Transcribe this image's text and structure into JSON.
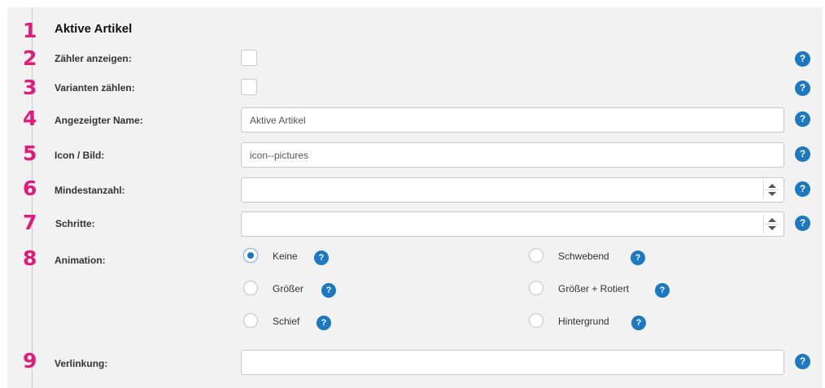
{
  "section": {
    "title": "Aktive Artikel",
    "help_glyph": "?"
  },
  "rows": {
    "show_counter": {
      "step": "1",
      "number": "2",
      "label": "Zähler anzeigen:",
      "checked": false
    },
    "count_variants": {
      "number": "3",
      "label": "Varianten zählen:",
      "checked": false
    },
    "display_name": {
      "number": "4",
      "label": "Angezeigter Name:",
      "value": "Aktive Artikel"
    },
    "icon": {
      "number": "5",
      "label": "Icon / Bild:",
      "value": "icon--pictures"
    },
    "min_count": {
      "number": "6",
      "label": "Mindestanzahl:",
      "value": ""
    },
    "steps": {
      "number": "7",
      "label": "Schritte:",
      "value": ""
    },
    "animation": {
      "number": "8",
      "label": "Animation:",
      "options": [
        {
          "label": "Keine",
          "selected": true
        },
        {
          "label": "Schwebend",
          "selected": false
        },
        {
          "label": "Größer",
          "selected": false
        },
        {
          "label": "Größer + Rotiert",
          "selected": false
        },
        {
          "label": "Schief",
          "selected": false
        },
        {
          "label": "Hintergrund",
          "selected": false
        }
      ]
    },
    "link": {
      "number": "9",
      "label": "Verlinkung:",
      "value": ""
    }
  },
  "colors": {
    "step_number": "#e5197a",
    "help_icon": "#1c78c0",
    "panel_bg": "#f2f2f2"
  }
}
